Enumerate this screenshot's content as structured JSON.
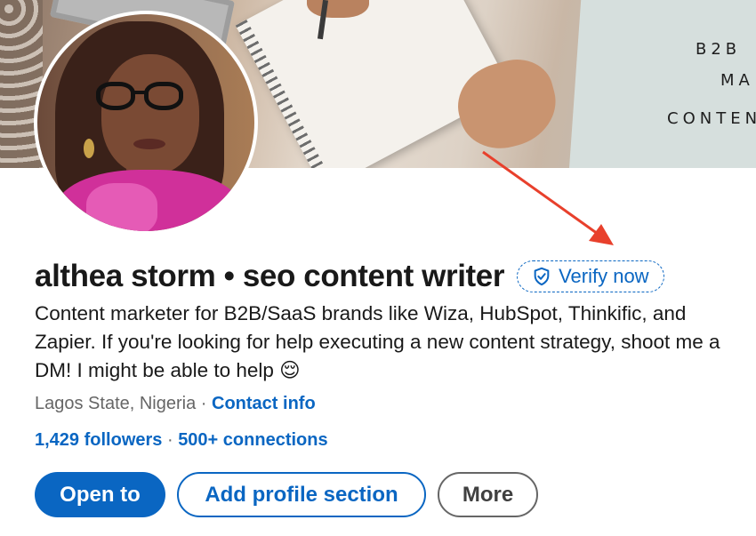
{
  "banner": {
    "card_lines": [
      "B2B",
      "MA",
      "CONTEN"
    ]
  },
  "profile": {
    "name": "althea storm • seo content writer",
    "verify_label": "Verify now",
    "headline": "Content marketer for B2B/SaaS brands like Wiza, HubSpot, Thinkific, and Zapier. If you're looking for help executing a new content strategy, shoot me a DM! I might be able to help 😌",
    "location": "Lagos State, Nigeria",
    "location_sep": " · ",
    "contact_label": "Contact info",
    "followers": "1,429 followers",
    "stats_sep": " · ",
    "connections": "500+ connections"
  },
  "actions": {
    "open_to": "Open to",
    "add_section": "Add profile section",
    "more": "More"
  },
  "colors": {
    "brand_blue": "#0a66c2",
    "arrow_red": "#e8402c"
  },
  "icons": {
    "verify": "shield-check-icon"
  }
}
